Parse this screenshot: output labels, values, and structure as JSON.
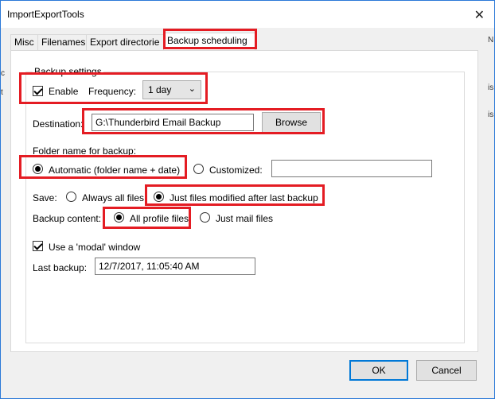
{
  "window": {
    "title": "ImportExportTools",
    "close_glyph": "✕"
  },
  "background": {
    "left_glyphs": [
      "c",
      "t"
    ],
    "right_glyphs": [
      "N",
      "is",
      "is"
    ]
  },
  "tabs": [
    {
      "label": "Misc"
    },
    {
      "label": "Filenames"
    },
    {
      "label": "Export directorie"
    },
    {
      "label": "Backup scheduling"
    }
  ],
  "backup": {
    "group_label": "Backup settings",
    "enable_label": "Enable",
    "frequency_label": "Frequency:",
    "frequency_value": "1 day",
    "destination_label": "Destination:",
    "destination_value": "G:\\Thunderbird Email Backup",
    "browse_label": "Browse",
    "folder_name_label": "Folder name for backup:",
    "automatic_label": "Automatic (folder name + date)",
    "customized_label": "Customized:",
    "customized_value": "",
    "save_label": "Save:",
    "always_all_label": "Always all files",
    "just_modified_label": "Just files modified after last backup",
    "content_label": "Backup content:",
    "all_profile_label": "All profile files",
    "just_mail_label": "Just mail files",
    "modal_label": "Use a 'modal' window",
    "last_backup_label": "Last backup:",
    "last_backup_value": "12/7/2017, 11:05:40 AM"
  },
  "footer": {
    "ok_label": "OK",
    "cancel_label": "Cancel"
  },
  "colors": {
    "highlight": "#e41c23",
    "accent": "#0078d7"
  }
}
